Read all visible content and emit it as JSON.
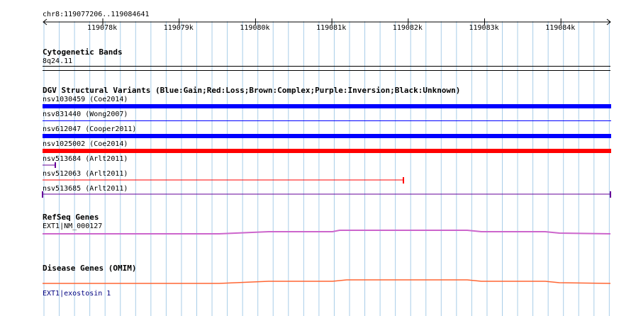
{
  "location": "chr8:119077206..119084641",
  "ruler": {
    "ticks": [
      "119078k",
      "119079k",
      "119080k",
      "119081k",
      "119082k",
      "119083k",
      "119084k"
    ]
  },
  "tracks": {
    "cytoband": {
      "title": "Cytogenetic Bands",
      "band": "8q24.11"
    },
    "dgv": {
      "title": "DGV Structural Variants (Blue:Gain;Red:Loss;Brown:Complex;Purple:Inversion;Black:Unknown)",
      "variants": [
        {
          "label": "nsv1030459 (Coe2014)",
          "type": "Gain",
          "color": "#0000ff"
        },
        {
          "label": "nsv831440 (Wong2007)",
          "type": "Gain",
          "color": "#0000ff"
        },
        {
          "label": "nsv612047 (Cooper2011)",
          "type": "Gain",
          "color": "#0000ff"
        },
        {
          "label": "nsv1025002 (Coe2014)",
          "type": "Loss",
          "color": "#ff0000"
        },
        {
          "label": "nsv513684 (Arlt2011)",
          "type": "Inversion",
          "color": "#660099"
        },
        {
          "label": "nsv512063 (Arlt2011)",
          "type": "Loss",
          "color": "#ff0000"
        },
        {
          "label": "nsv513685 (Arlt2011)",
          "type": "Inversion",
          "color": "#660099"
        }
      ]
    },
    "refseq": {
      "title": "RefSeq Genes",
      "gene": "EXT1|NM_000127",
      "color": "#cc66cc"
    },
    "omim": {
      "title": "Disease Genes (OMIM)",
      "gene": "EXT1|exostosin 1",
      "color": "#ff6633"
    }
  },
  "colors": {
    "grid": "#a8cde8",
    "text_link": "#000080"
  }
}
